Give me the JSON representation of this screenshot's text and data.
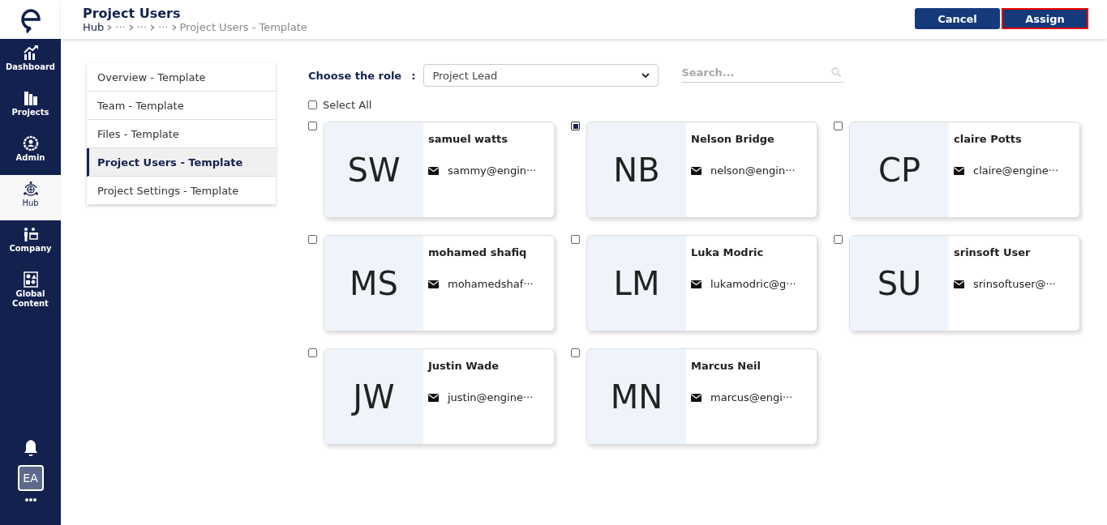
{
  "header": {
    "title": "Project Users",
    "breadcrumb": [
      "Hub",
      "···",
      "···",
      "···",
      "Project Users - Template"
    ],
    "buttons": [
      {
        "label": "Cancel",
        "selected": false
      },
      {
        "label": "Assign",
        "selected": true
      }
    ]
  },
  "sidebar": {
    "items": [
      {
        "label": "Dashboard",
        "kind": "chart",
        "selected": false
      },
      {
        "label": "Projects",
        "kind": "buildings",
        "selected": false
      },
      {
        "label": "Admin",
        "kind": "admin",
        "selected": false
      },
      {
        "label": "Hub",
        "kind": "hub",
        "selected": true
      },
      {
        "label": "Company",
        "kind": "company",
        "selected": false
      },
      {
        "label": "Global Content",
        "kind": "content",
        "selected": false
      }
    ],
    "avatar": "EA"
  },
  "tabs": [
    {
      "label": "Overview - Template",
      "selected": false
    },
    {
      "label": "Team - Template",
      "selected": false
    },
    {
      "label": "Files - Template",
      "selected": false
    },
    {
      "label": "Project Users - Template",
      "selected": true
    },
    {
      "label": "Project Settings - Template",
      "selected": false
    }
  ],
  "role": {
    "label": "Choose the role",
    "separator": ":",
    "value": "Project Lead"
  },
  "search": {
    "placeholder": "Search..."
  },
  "select_all": {
    "label": "Select All",
    "checked": false
  },
  "users": [
    {
      "initials": "SW",
      "name": "samuel watts",
      "email": "sammy@engin···",
      "checked": false
    },
    {
      "initials": "NB",
      "name": "Nelson Bridge",
      "email": "nelson@engin···",
      "checked": true
    },
    {
      "initials": "CP",
      "name": "claire Potts",
      "email": "claire@engine···",
      "checked": false
    },
    {
      "initials": "MS",
      "name": "mohamed shafiq",
      "email": "mohamedshaf···",
      "checked": false
    },
    {
      "initials": "LM",
      "name": "Luka Modric",
      "email": "lukamodric@g···",
      "checked": false
    },
    {
      "initials": "SU",
      "name": "srinsoft User",
      "email": "srinsoftuser@···",
      "checked": false
    },
    {
      "initials": "JW",
      "name": "Justin Wade",
      "email": "justin@engine···",
      "checked": false
    },
    {
      "initials": "MN",
      "name": "Marcus Neil",
      "email": "marcus@engi···",
      "checked": false
    }
  ]
}
